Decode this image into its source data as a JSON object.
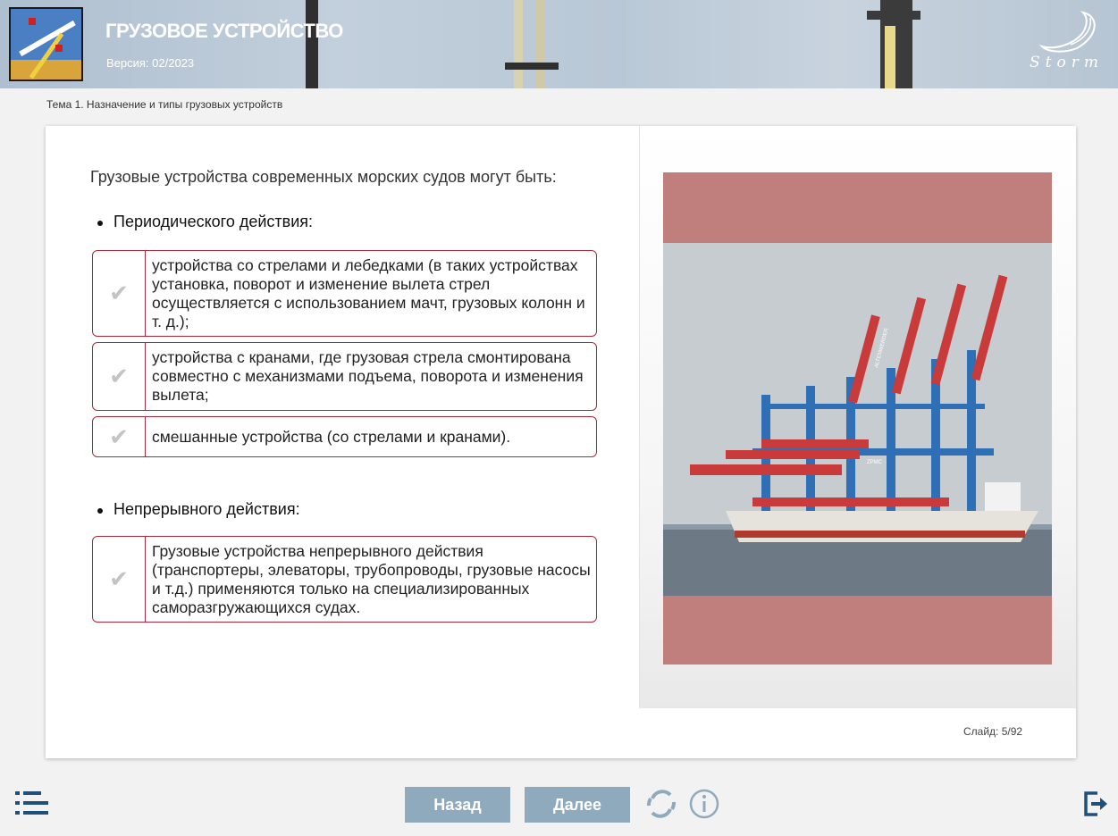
{
  "header": {
    "title": "ГРУЗОВОЕ УСТРОЙСТВО",
    "version": "Версия: 02/2023",
    "brand": "Storm"
  },
  "topic": "Тема 1. Назначение и типы грузовых устройств",
  "content": {
    "intro": "Грузовые устройства современных морских судов могут быть:",
    "sections": [
      {
        "heading": "Периодического действия:",
        "items": [
          "устройства со стрелами и лебедками (в таких устройствах установка, поворот и изменение вылета стрел осуществляется с использованием мачт, грузовых колонн и т. д.);",
          "устройства с кранами, где грузовая стрела смонтирована совместно с механизмами подъема, поворота и изменения вылета;",
          "смешанные устройства (со стрелами и кранами)."
        ]
      },
      {
        "heading": "Непрерывного действия:",
        "items": [
          "Грузовые устройства непрерывного действия (транспортеры, элеваторы, трубопроводы, грузовые насосы и т.д.) применяются только на специализированных саморазгружающихся судах."
        ]
      }
    ],
    "check_icon": "check-icon",
    "photo_labels": [
      "ZPMC",
      "ALTENWERDER"
    ]
  },
  "slide_counter": "Слайд:  5/92",
  "nav": {
    "back_label": "Назад",
    "next_label": "Далее",
    "menu_icon": "list-menu-icon",
    "reload_icon": "reload-icon",
    "info_icon": "info-icon",
    "exit_icon": "exit-icon"
  },
  "colors": {
    "accent_border": "#a82a3a",
    "nav_button": "#8fa9bd",
    "icon_blue": "#1f4f7a",
    "photo_frame": "#c07f7d"
  }
}
